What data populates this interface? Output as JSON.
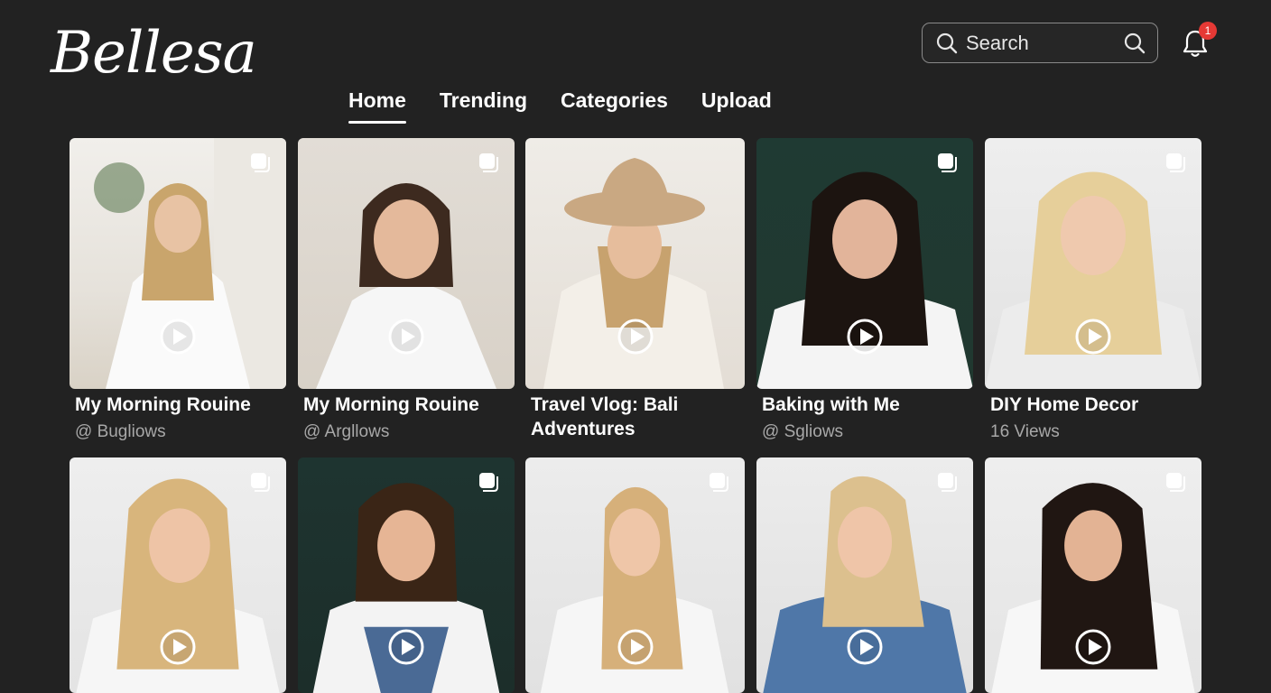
{
  "app": {
    "logo": "Bellesa"
  },
  "header": {
    "search_placeholder": "Search",
    "notification_count": "1"
  },
  "nav": {
    "tabs": [
      {
        "label": "Home",
        "active": true
      },
      {
        "label": "Trending",
        "active": false
      },
      {
        "label": "Categories",
        "active": false
      },
      {
        "label": "Upload",
        "active": false
      }
    ]
  },
  "videos": {
    "row1": [
      {
        "title": "My Morning Rouine",
        "sub": "@ Bugliows",
        "icon": "play-circle-icon"
      },
      {
        "title": "My Morning Rouine",
        "sub": "@ Argllows",
        "icon": "play-circle-icon"
      },
      {
        "title": "Travel Vlog: Bali Adventures",
        "sub": "",
        "icon": "play-circle-icon"
      },
      {
        "title": "Baking with Me",
        "sub": "@ Sgliows",
        "icon": "play-circle-icon"
      },
      {
        "title": "DIY Home Decor",
        "sub": "16 Views",
        "icon": "play-circle-icon"
      }
    ],
    "row2": [
      {
        "icon": "play-circle-icon"
      },
      {
        "icon": "play-circle-icon"
      },
      {
        "icon": "play-circle-icon"
      },
      {
        "icon": "play-circle-icon"
      },
      {
        "icon": "play-circle-icon"
      }
    ]
  },
  "colors": {
    "background": "#222222",
    "text": "#ffffff",
    "muted_text": "#a8a8a8",
    "badge": "#e53935"
  }
}
